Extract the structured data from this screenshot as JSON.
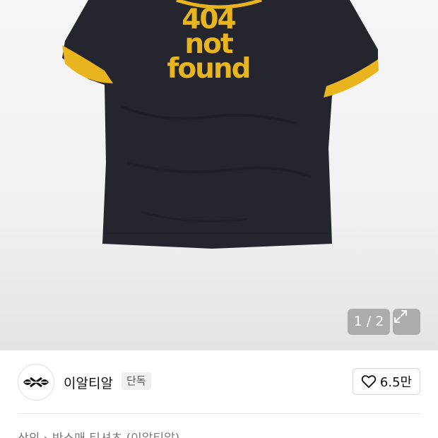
{
  "product_image": {
    "print_lines": [
      "404",
      "not",
      "found"
    ],
    "shirt_color": "#24252d",
    "trim_color": "#e9b51f"
  },
  "gallery": {
    "counter": "1 / 2",
    "expand_icon": "expand-icon"
  },
  "brand": {
    "name": "이알티알",
    "badge": "단독",
    "logo_icon": "brand-logo-icon"
  },
  "like": {
    "icon": "heart-icon",
    "count": "6.5만"
  },
  "breadcrumb": {
    "text": "상의 › 반소매 티셔츠 (이알티알)"
  }
}
